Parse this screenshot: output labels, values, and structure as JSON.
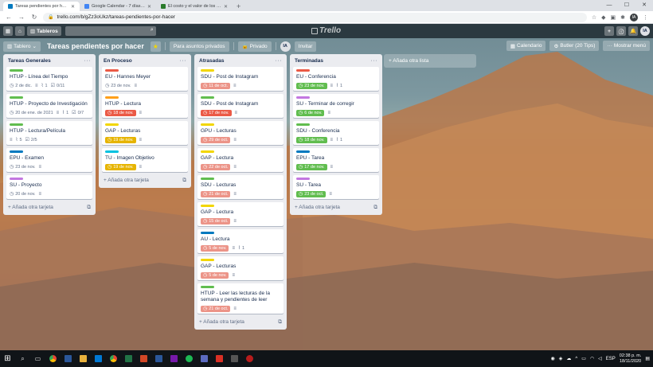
{
  "browser": {
    "tabs": [
      {
        "title": "Tareas pendientes por hacer | Trello",
        "favicon_color": "#0079bf",
        "active": true
      },
      {
        "title": "Google Calendar - 7 días, a partir del...",
        "favicon_color": "#4285f4",
        "active": false
      },
      {
        "title": "El costo y el valor de los árboles...",
        "favicon_color": "#2a7a2a",
        "active": false
      }
    ],
    "new_tab": "+",
    "url": "trello.com/b/gZz3oUkz/tareas-pendientes-por-hacer",
    "profile": "IA"
  },
  "trello_header": {
    "boards_label": "Tableros",
    "logo": "Trello",
    "avatar": "IA"
  },
  "board_header": {
    "view_label": "Tablero",
    "title": "Tareas pendientes por hacer",
    "team_label": "Para asuntos privados",
    "visibility_label": "Privado",
    "member_avatar": "IA",
    "invite_label": "Invitar",
    "calendar_label": "Calendario",
    "butler_label": "Butler (20 Tips)",
    "menu_label": "Mostrar menú"
  },
  "label_colors": {
    "green": "#61bd4f",
    "orange": "#ff9f1a",
    "red": "#eb5a46",
    "yellow": "#f2d600",
    "blue": "#0079bf",
    "sky": "#00c2e0",
    "purple": "#c377e0"
  },
  "status_colors": {
    "overdue": "#eb5a46",
    "due_soon": "#e6b400",
    "complete": "#61bd4f"
  },
  "lists": [
    {
      "name": "Tareas Generales",
      "add_card": "Añada otra tarjeta",
      "cards": [
        {
          "label": "green",
          "title": "HTUP - Línea del Tiempo",
          "due": "2 de dic.",
          "due_status": "plain",
          "attachments": "1",
          "checklist": "0/11"
        },
        {
          "label": "green",
          "title": "HTUP - Proyecto de Investigación",
          "due": "20 de ene. de 2021",
          "due_status": "plain",
          "attachments": "1",
          "checklist": "0/7"
        },
        {
          "label": "green",
          "title": "HTUP - Lectura/Película",
          "due": "",
          "due_status": "none",
          "attachments": "5",
          "checklist": "2/5"
        },
        {
          "label": "blue",
          "title": "EPU - Examen",
          "due": "23 de nov.",
          "due_status": "plain",
          "attachments": "",
          "checklist": ""
        },
        {
          "label": "purple",
          "title": "SU - Proyecto",
          "due": "20 de nov.",
          "due_status": "plain",
          "attachments": "",
          "checklist": ""
        }
      ]
    },
    {
      "name": "En Proceso",
      "add_card": "Añada otra tarjeta",
      "cards": [
        {
          "label": "red",
          "title": "EU - Hannes Meyer",
          "due": "23 de nov.",
          "due_status": "plain",
          "attachments": "",
          "checklist": ""
        },
        {
          "label": "orange",
          "title": "HTUP - Lectura",
          "due": "18 de nov.",
          "due_status": "overdue",
          "attachments": "",
          "checklist": ""
        },
        {
          "label": "yellow",
          "title": "GAP - Lecturas",
          "due": "19 de nov.",
          "due_status": "due_soon",
          "attachments": "",
          "checklist": ""
        },
        {
          "label": "sky",
          "title": "TU - Imagen Objetivo",
          "due": "19 de nov.",
          "due_status": "due_soon",
          "attachments": "",
          "checklist": ""
        }
      ]
    },
    {
      "name": "Atrasadas",
      "add_card": "Añada otra tarjeta",
      "cards": [
        {
          "label": "yellow",
          "title": "SDU - Post de Instagram",
          "due": "11 de oct.",
          "due_status": "overdue_light",
          "attachments": "",
          "checklist": ""
        },
        {
          "label": "green",
          "title": "SDU - Post de Instagram",
          "due": "17 de nov.",
          "due_status": "overdue",
          "attachments": "",
          "checklist": ""
        },
        {
          "label": "yellow",
          "title": "GPU - Lecturas",
          "due": "29 de oct.",
          "due_status": "overdue_light",
          "attachments": "",
          "checklist": ""
        },
        {
          "label": "yellow",
          "title": "GAP - Lectura",
          "due": "22 de oct.",
          "due_status": "overdue_light",
          "attachments": "",
          "checklist": ""
        },
        {
          "label": "green",
          "title": "SDU - Lecturas",
          "due": "21 de oct.",
          "due_status": "overdue_light",
          "attachments": "",
          "checklist": ""
        },
        {
          "label": "yellow",
          "title": "GAP - Lectura",
          "due": "15 de oct.",
          "due_status": "overdue_light",
          "attachments": "",
          "checklist": ""
        },
        {
          "label": "blue",
          "title": "AU - Lectura",
          "due": "5 de nov.",
          "due_status": "overdue_light",
          "attachments": "1",
          "checklist": ""
        },
        {
          "label": "yellow",
          "title": "GAP - Lecturas",
          "due": "5 de nov.",
          "due_status": "overdue_light",
          "attachments": "",
          "checklist": ""
        },
        {
          "label": "green",
          "title": "HTUP - Leer las lecturas de la semana y pendientes de leer",
          "due": "21 de oct.",
          "due_status": "overdue_light",
          "attachments": "",
          "checklist": ""
        }
      ]
    },
    {
      "name": "Terminadas",
      "add_card": "Añada otra tarjeta",
      "cards": [
        {
          "label": "red",
          "title": "EU - Conferencia",
          "due": "23 de nov.",
          "due_status": "complete",
          "attachments": "1",
          "checklist": ""
        },
        {
          "label": "purple",
          "title": "SU - Terminar de corregir",
          "due": "6 de nov.",
          "due_status": "complete",
          "attachments": "",
          "checklist": ""
        },
        {
          "label": "green",
          "title": "SDU - Conferencia",
          "due": "18 de nov.",
          "due_status": "complete",
          "attachments": "1",
          "checklist": ""
        },
        {
          "label": "blue",
          "title": "EPU - Tarea",
          "due": "17 de nov.",
          "due_status": "complete",
          "attachments": "",
          "checklist": ""
        },
        {
          "label": "purple",
          "title": "SU - Tarea",
          "due": "23 de oct.",
          "due_status": "complete",
          "attachments": "",
          "checklist": ""
        }
      ]
    }
  ],
  "add_list": "+ Añada otra lista",
  "taskbar": {
    "lang": "ESP",
    "time": "02:38 p. m.",
    "date": "18/11/2020"
  }
}
